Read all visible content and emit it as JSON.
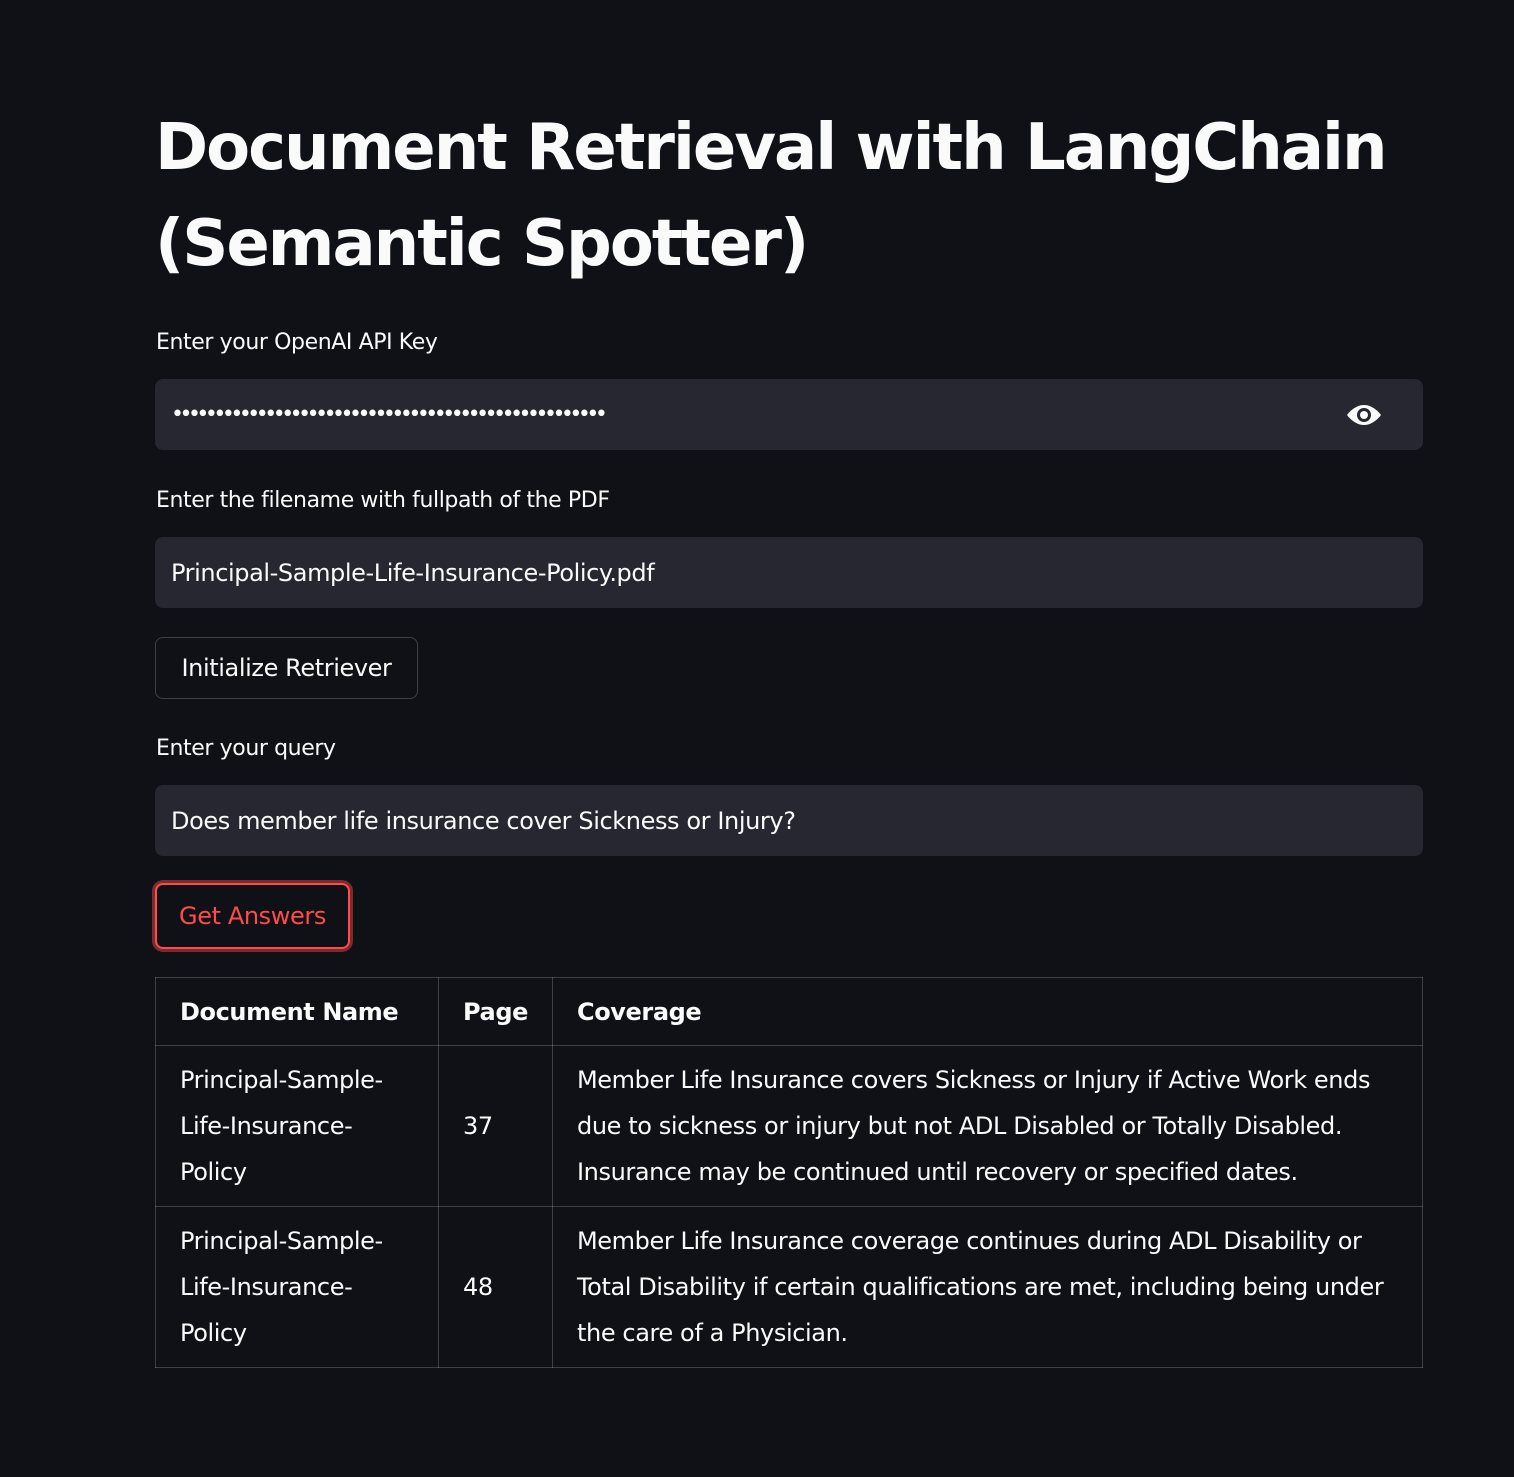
{
  "title": "Document Retrieval with LangChain (Semantic Spotter)",
  "api_key": {
    "label": "Enter your OpenAI API Key",
    "masked_value": "•••••••••••••••••••••••••••••••••••••••••••••••••••"
  },
  "pdf": {
    "label": "Enter the filename with fullpath of the PDF",
    "value": "Principal-Sample-Life-Insurance-Policy.pdf"
  },
  "initialize_button": "Initialize Retriever",
  "query": {
    "label": "Enter your query",
    "value": "Does member life insurance cover Sickness or Injury?"
  },
  "get_answers_button": "Get Answers",
  "colors": {
    "background": "#0f1117",
    "field": "#262730",
    "accent": "#ff4b4b",
    "text": "#fafafa"
  },
  "table": {
    "headers": [
      "Document Name",
      "Page",
      "Coverage"
    ],
    "rows": [
      {
        "doc": "Principal-Sample-Life-Insurance-Policy",
        "page": "37",
        "coverage": "Member Life Insurance covers Sickness or Injury if Active Work ends due to sickness or injury but not ADL Disabled or Totally Disabled. Insurance may be continued until recovery or specified dates."
      },
      {
        "doc": "Principal-Sample-Life-Insurance-Policy",
        "page": "48",
        "coverage": "Member Life Insurance coverage continues during ADL Disability or Total Disability if certain qualifications are met, including being under the care of a Physician."
      }
    ]
  }
}
